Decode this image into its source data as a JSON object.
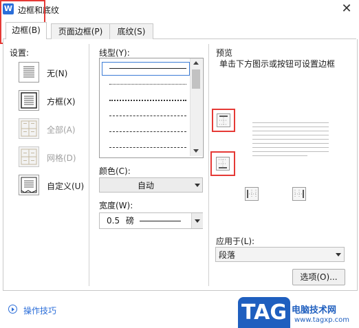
{
  "window": {
    "title": "边框和底纹",
    "close_glyph": "✕"
  },
  "tabs": [
    {
      "label": "边框(B)",
      "active": true
    },
    {
      "label": "页面边框(P)",
      "active": false
    },
    {
      "label": "底纹(S)",
      "active": false
    }
  ],
  "settings": {
    "heading": "设置:",
    "items": [
      {
        "label": "无(N)",
        "icon": "border-none-icon",
        "disabled": false
      },
      {
        "label": "方框(X)",
        "icon": "border-box-icon",
        "disabled": false
      },
      {
        "label": "全部(A)",
        "icon": "border-all-icon",
        "disabled": true
      },
      {
        "label": "网格(D)",
        "icon": "border-grid-icon",
        "disabled": true
      },
      {
        "label": "自定义(U)",
        "icon": "border-custom-icon",
        "disabled": false
      }
    ]
  },
  "line_style": {
    "heading": "线型(Y):",
    "styles": [
      "solid",
      "dotted-fine",
      "dotted",
      "dashed",
      "dash-dot",
      "dash-dot-dot"
    ]
  },
  "color": {
    "heading": "颜色(C):",
    "value": "自动"
  },
  "width": {
    "heading": "宽度(W):",
    "value": "0.5",
    "unit": "磅"
  },
  "preview": {
    "heading": "预览",
    "hint": "单击下方图示或按钮可设置边框"
  },
  "apply_to": {
    "heading": "应用于(L):",
    "value": "段落"
  },
  "options_button": "选项(O)...",
  "tips_link": "操作技巧",
  "watermark": {
    "logo": "TAG",
    "site": "电脑技术网",
    "url": "www.tagxp.com"
  },
  "colors": {
    "highlight": "#e53935",
    "accent": "#2b6ed9"
  }
}
